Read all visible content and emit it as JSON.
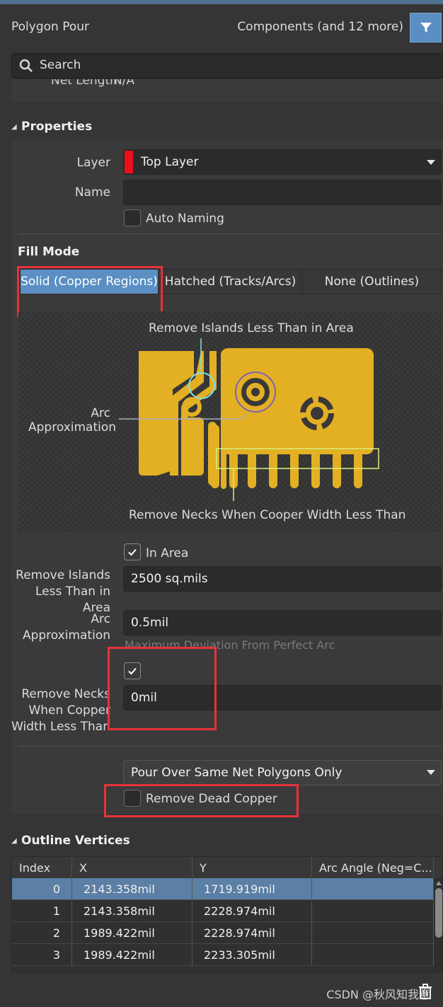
{
  "header": {
    "title": "Polygon Pour",
    "filter_summary": "Components (and 12 more)"
  },
  "search": {
    "placeholder": "Search"
  },
  "peek": {
    "label": "Net Length",
    "value": "N/A"
  },
  "properties": {
    "section_title": "Properties",
    "layer_label": "Layer",
    "layer_value": "Top Layer",
    "layer_color": "#e8101a",
    "name_label": "Name",
    "name_value": "",
    "auto_naming_label": "Auto Naming"
  },
  "fill_mode": {
    "section_title": "Fill Mode",
    "options": [
      "Solid (Copper Regions)",
      "Hatched (Tracks/Arcs)",
      "None (Outlines)"
    ],
    "selected": "Solid (Copper Regions)",
    "illustration": {
      "islands_caption": "Remove Islands Less Than in Area",
      "arc_caption_line1": "Arc",
      "arc_caption_line2": "Approximation",
      "necks_caption": "Remove Necks When Cooper Width Less Than"
    }
  },
  "options": {
    "in_area_label": "In Area",
    "islands_label_line1": "Remove Islands",
    "islands_label_line2": "Less Than in Area",
    "islands_value": "2500 sq.mils",
    "arc_label_line1": "Arc",
    "arc_label_line2": "Approximation",
    "arc_value": "0.5mil",
    "arc_hint": "Maximum Deviation From Perfect Arc",
    "necks_label_line1": "Remove Necks",
    "necks_label_line2": "When Copper",
    "necks_label_line3": "Width Less Than",
    "necks_value": "0mil",
    "pour_mode_value": "Pour Over Same Net Polygons Only",
    "dead_copper_label": "Remove Dead Copper"
  },
  "outline": {
    "section_title": "Outline Vertices",
    "columns": [
      "Index",
      "X",
      "Y",
      "Arc Angle (Neg=C..."
    ],
    "rows": [
      {
        "index": "0",
        "x": "2143.358mil",
        "y": "1719.919mil",
        "arc": ""
      },
      {
        "index": "1",
        "x": "2143.358mil",
        "y": "2228.974mil",
        "arc": ""
      },
      {
        "index": "2",
        "x": "1989.422mil",
        "y": "2228.974mil",
        "arc": ""
      },
      {
        "index": "3",
        "x": "1989.422mil",
        "y": "2233.305mil",
        "arc": ""
      }
    ]
  },
  "watermark": "CSDN @秋风知我意",
  "colors": {
    "accent": "#5b8fc4",
    "copper": "#e3b023",
    "highlight": "#e8323a",
    "callout": "#7fe0e8"
  }
}
